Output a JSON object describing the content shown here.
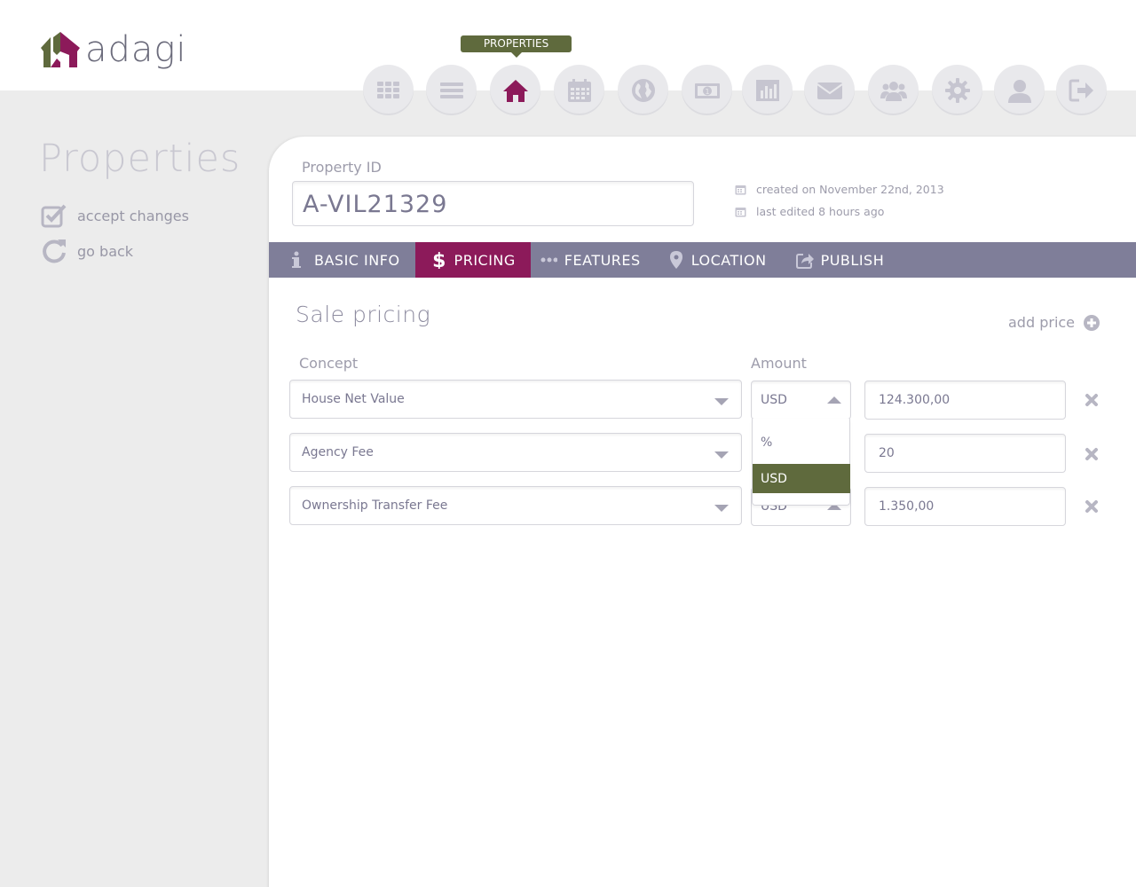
{
  "app": {
    "logo_text": "adagi"
  },
  "nav": {
    "tooltip": "PROPERTIES",
    "items": [
      {
        "icon": "grid-icon"
      },
      {
        "icon": "list-icon"
      },
      {
        "icon": "home-icon",
        "active": true
      },
      {
        "icon": "calendar-icon"
      },
      {
        "icon": "globe-icon"
      },
      {
        "icon": "money-icon"
      },
      {
        "icon": "bar-chart-icon"
      },
      {
        "icon": "envelope-icon"
      },
      {
        "icon": "users-icon"
      },
      {
        "icon": "gear-icon"
      },
      {
        "icon": "user-icon"
      },
      {
        "icon": "logout-icon"
      }
    ]
  },
  "sidebar": {
    "title": "Properties",
    "accept_label": "accept changes",
    "back_label": "go back"
  },
  "property": {
    "id_label": "Property ID",
    "id_value": "A-VIL21329",
    "created": "created on November 22nd, 2013",
    "edited": "last edited 8 hours ago"
  },
  "tabs": [
    {
      "label": "BASIC INFO",
      "icon": "info-icon"
    },
    {
      "label": "PRICING",
      "icon": "dollar-icon",
      "active": true
    },
    {
      "label": "FEATURES",
      "icon": "dots-icon"
    },
    {
      "label": "LOCATION",
      "icon": "map-marker-icon"
    },
    {
      "label": "PUBLISH",
      "icon": "share-icon"
    }
  ],
  "pricing": {
    "title": "Sale pricing",
    "add_label": "add price",
    "concept_label": "Concept",
    "amount_label": "Amount",
    "rows": [
      {
        "concept": "House Net Value",
        "unit": "USD",
        "amount": "124.300,00"
      },
      {
        "concept": "Agency Fee",
        "unit": "",
        "amount": "20"
      },
      {
        "concept": "Ownership Transfer Fee",
        "unit": "USD",
        "amount": "1.350,00"
      }
    ],
    "unit_options": [
      "%",
      "USD"
    ],
    "selected_option": "USD"
  },
  "colors": {
    "accent": "#8c1a5a",
    "olive": "#5f6a3d",
    "tabbar": "#7f7e99"
  }
}
